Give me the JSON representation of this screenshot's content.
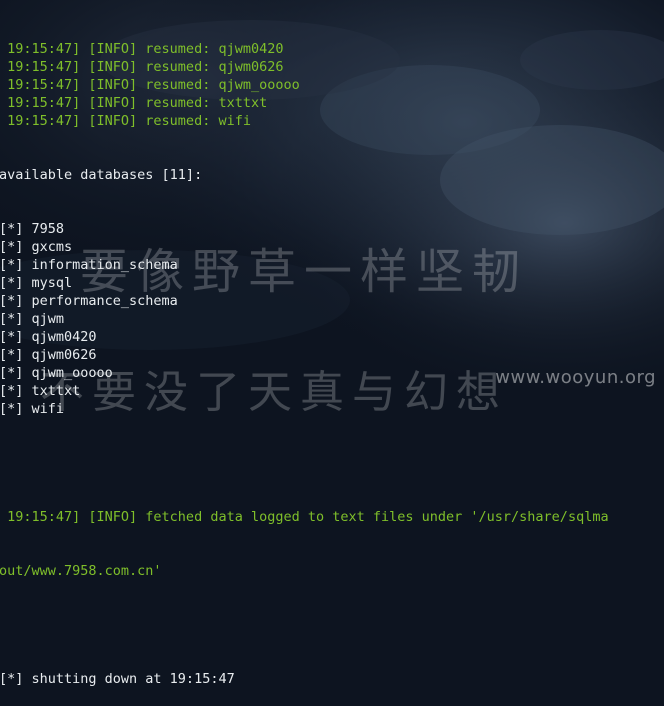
{
  "log_lines": [
    {
      "text": " 19:15:47] [INFO] resumed: qjwm0420",
      "color": "#7fbf2a"
    },
    {
      "text": " 19:15:47] [INFO] resumed: qjwm0626",
      "color": "#7fbf2a"
    },
    {
      "text": " 19:15:47] [INFO] resumed: qjwm_ooooo",
      "color": "#7fbf2a"
    },
    {
      "text": " 19:15:47] [INFO] resumed: txttxt",
      "color": "#7fbf2a"
    },
    {
      "text": " 19:15:47] [INFO] resumed: wifi",
      "color": "#7fbf2a"
    }
  ],
  "databases": {
    "header": "available databases [11]:",
    "items": [
      "[*] 7958",
      "[*] gxcms",
      "[*] information_schema",
      "[*] mysql",
      "[*] performance_schema",
      "[*] qjwm",
      "[*] qjwm0420",
      "[*] qjwm0626",
      "[*] qjwm_ooooo",
      "[*] txttxt",
      "[*] wifi"
    ]
  },
  "fetched": {
    "line1": " 19:15:47] [INFO] fetched data logged to text files under '/usr/share/sqlma",
    "line2": "out/www.7958.com.cn'"
  },
  "shutdown": "[*] shutting down at 19:15:47",
  "watermark": {
    "line1": "要像野草一样坚韧",
    "line2": "不要没了天真与幻想",
    "brand": "www.wooyun.org"
  },
  "colors": {
    "info_green": "#7fbf2a",
    "text_white": "#e8ecef",
    "background": "#0d1420"
  }
}
